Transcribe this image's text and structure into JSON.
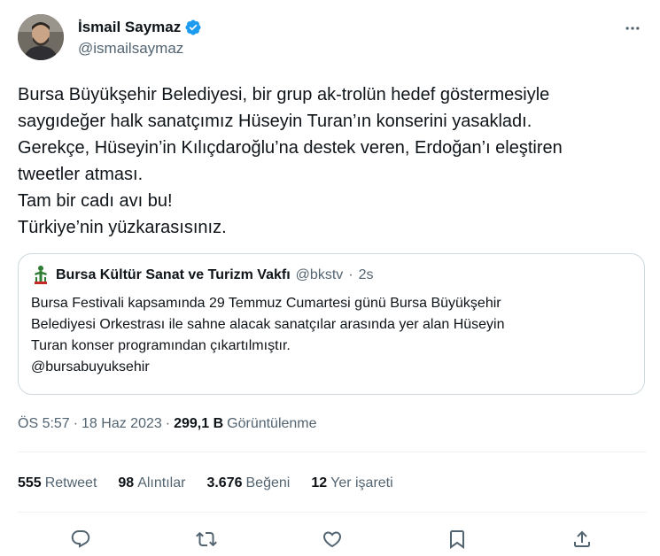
{
  "author": {
    "name": "İsmail Saymaz",
    "handle": "@ismailsaymaz"
  },
  "tweet": {
    "lines": [
      "Bursa Büyükşehir Belediyesi, bir grup ak-trolün hedef göstermesiyle",
      "saygıdeğer halk sanatçımız Hüseyin Turan’ın konserini yasakladı.",
      "Gerekçe, Hüseyin’in Kılıçdaroğlu’na destek veren, Erdoğan’ı eleştiren",
      "tweetler atması.",
      "Tam bir cadı avı bu!",
      "Türkiye’nin yüzkarasısınız."
    ]
  },
  "quote": {
    "name": "Bursa Kültür Sanat ve Turizm Vakfı",
    "handle": "@bkstv",
    "separator": "·",
    "time": "2s",
    "lines": [
      "Bursa Festivali kapsamında 29 Temmuz Cumartesi günü Bursa Büyükşehir",
      "Belediyesi Orkestrası ile sahne alacak sanatçılar arasında yer alan Hüseyin",
      "Turan konser programından çıkartılmıştır.",
      "@bursabuyuksehir"
    ]
  },
  "meta": {
    "time": "ÖS 5:57",
    "dot1": "·",
    "date": "18 Haz 2023",
    "dot2": "·",
    "views_count": "299,1 B",
    "views_label": "Görüntülenme"
  },
  "stats": [
    {
      "count": "555",
      "label": "Retweet"
    },
    {
      "count": "98",
      "label": "Alıntılar"
    },
    {
      "count": "3.676",
      "label": "Beğeni"
    },
    {
      "count": "12",
      "label": "Yer işareti"
    }
  ],
  "icons": {
    "more": "more-icon",
    "verified": "verified-badge-icon",
    "reply": "reply-icon",
    "retweet": "retweet-icon",
    "like": "like-icon",
    "bookmark": "bookmark-icon",
    "share": "share-icon"
  },
  "colors": {
    "verified": "#1d9bf0",
    "text": "#0f1419",
    "secondary": "#536471",
    "border": "#cfd9de",
    "logo": "#2e7d32"
  }
}
